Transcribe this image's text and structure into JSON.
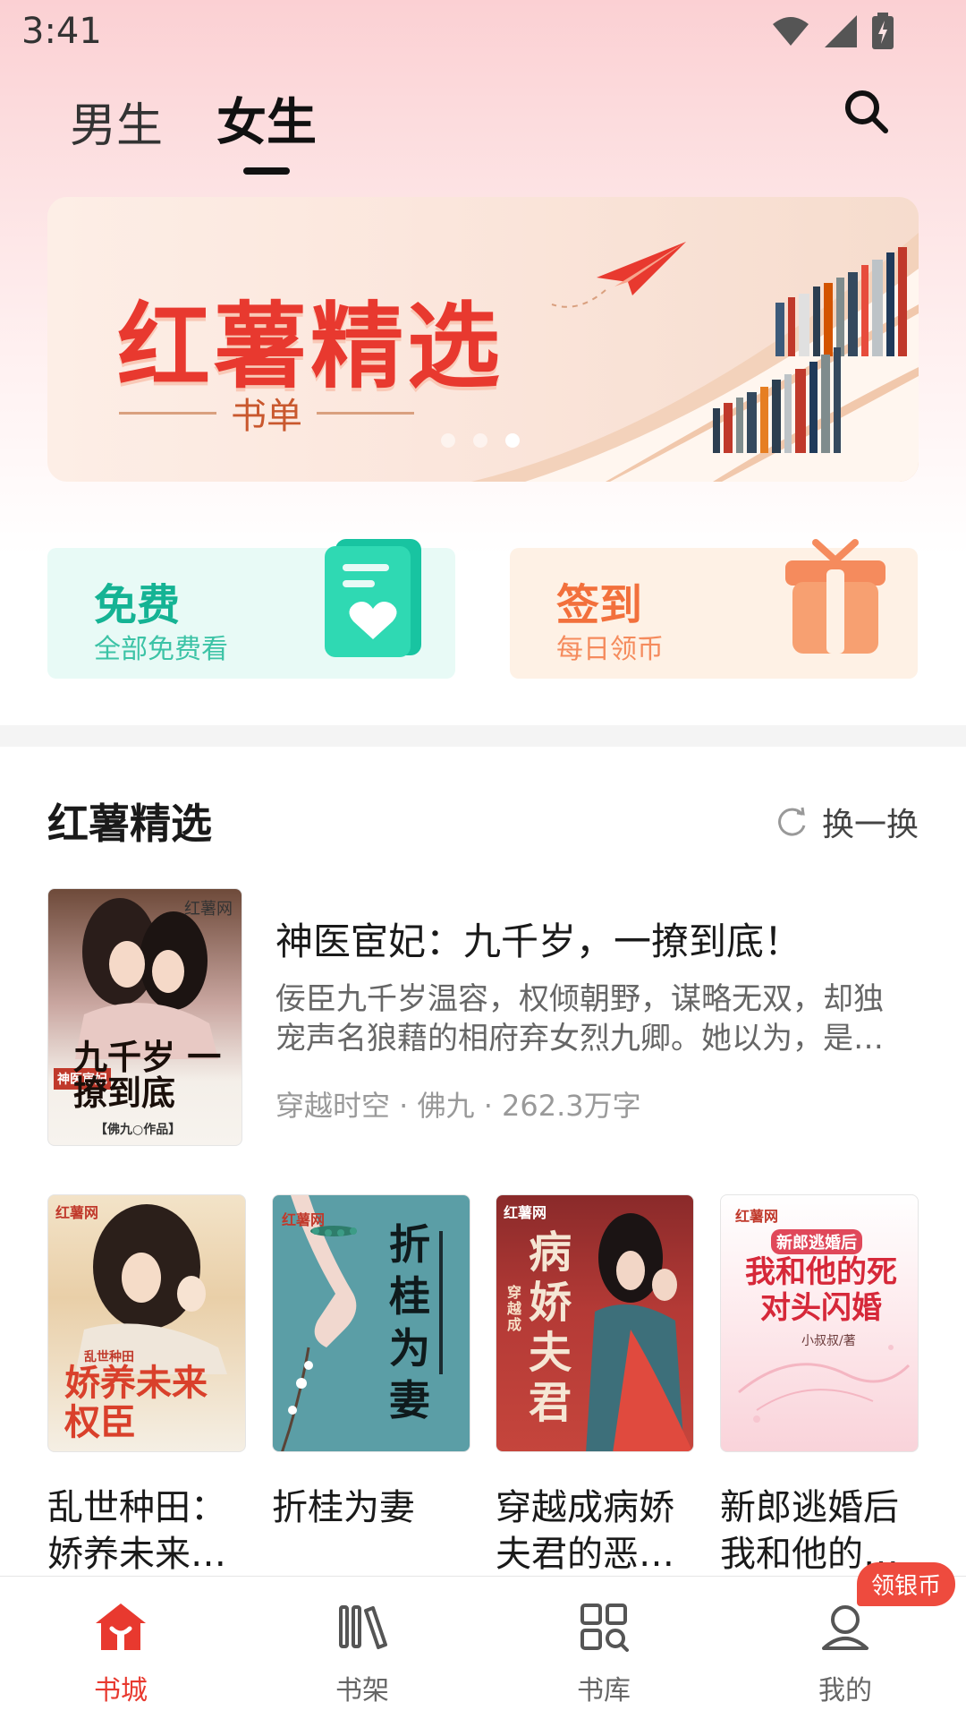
{
  "status_bar": {
    "time": "3:41"
  },
  "tabs": [
    {
      "label": "男生",
      "active": false
    },
    {
      "label": "女生",
      "active": true
    }
  ],
  "banner": {
    "title": "红薯精选",
    "subtitle": "书单",
    "page_count": 3,
    "active_page": 3
  },
  "quick_cards": [
    {
      "title": "免费",
      "desc": "全部免费看",
      "color": "#15b394"
    },
    {
      "title": "签到",
      "desc": "每日领币",
      "color": "#f2703c"
    }
  ],
  "section": {
    "title": "红薯精选",
    "refresh_label": "换一换"
  },
  "featured": {
    "title": "神医宦妃：九千岁，一撩到底！",
    "desc": "佞臣九千岁温容，权倾朝野，谋略无双，却独宠声名狼藉的相府弃女烈九卿。她以为，是…",
    "meta": "穿越时空 · 佛九 · 262.3万字",
    "cover_brand": "红薯网",
    "cover_text": "九千岁 一撩到底",
    "cover_tag": "神医宦妃",
    "cover_author": "【佛九○作品】"
  },
  "books": [
    {
      "title": "乱世种田：娇养未来…",
      "cover_brand": "红薯网",
      "cover_text": "娇养未来权臣",
      "cover_tag": "乱世种田"
    },
    {
      "title": "折桂为妻",
      "cover_brand": "红薯网",
      "cover_text": "折桂为妻"
    },
    {
      "title": "穿越成病娇夫君的恶…",
      "cover_brand": "红薯网",
      "cover_text": "病娇夫君",
      "cover_tag": "穿越成"
    },
    {
      "title": "新郎逃婚后我和他的…",
      "cover_brand": "红薯网",
      "cover_text": "我和他的死对头闪婚",
      "cover_tag": "新郎逃婚后",
      "cover_author": "小叔叔/著"
    }
  ],
  "bottom_nav": [
    {
      "label": "书城",
      "icon": "home-icon",
      "active": true
    },
    {
      "label": "书架",
      "icon": "bookshelf-icon",
      "active": false
    },
    {
      "label": "书库",
      "icon": "library-grid-icon",
      "active": false
    },
    {
      "label": "我的",
      "icon": "profile-icon",
      "active": false,
      "badge": "领银币"
    }
  ],
  "colors": {
    "accent": "#e8392f",
    "free_green": "#15b394",
    "sign_orange": "#f2703c"
  }
}
